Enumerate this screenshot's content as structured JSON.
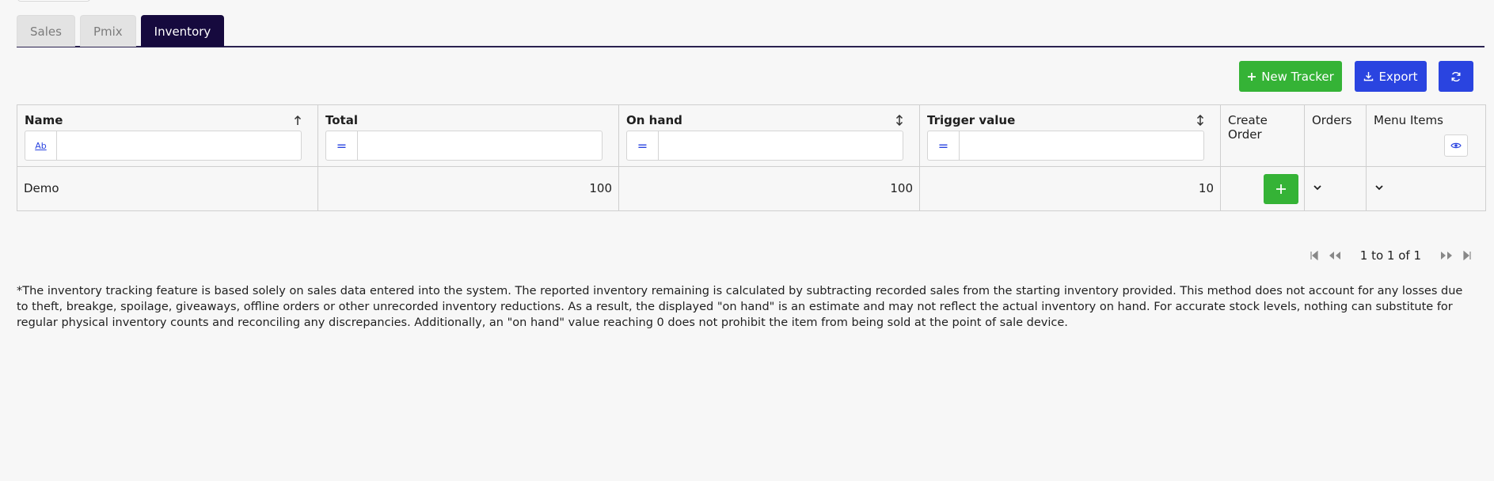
{
  "tabs": [
    {
      "label": "Sales",
      "active": false
    },
    {
      "label": "Pmix",
      "active": false
    },
    {
      "label": "Inventory",
      "active": true
    }
  ],
  "toolbar": {
    "new_tracker_label": "New Tracker",
    "export_label": "Export",
    "refresh_icon": "refresh-icon"
  },
  "colors": {
    "active_tab": "#160a3e",
    "green": "#35b336",
    "blue": "#2a44e0"
  },
  "grid": {
    "columns": {
      "name": "Name",
      "total": "Total",
      "on_hand": "On hand",
      "trigger_value": "Trigger value",
      "create_order": "Create Order",
      "orders": "Orders",
      "menu_items": "Menu Items"
    },
    "filters": {
      "name_type": "Ab",
      "total_type": "=",
      "on_hand_type": "=",
      "trigger_type": "=",
      "name_value": "",
      "total_value": "",
      "on_hand_value": "",
      "trigger_value": ""
    },
    "rows": [
      {
        "name": "Demo",
        "total": "100",
        "on_hand": "100",
        "trigger_value": "10"
      }
    ]
  },
  "pager": {
    "text": "1 to 1 of 1"
  },
  "note": "*The inventory tracking feature is based solely on sales data entered into the system. The reported inventory remaining is calculated by subtracting recorded sales from the starting inventory provided. This method does not account for any losses due to theft, breakge, spoilage, giveaways, offline orders or other unrecorded inventory reductions. As a result, the displayed \"on hand\" is an estimate and may not reflect the actual inventory on hand. For accurate stock levels, nothing can substitute for regular physical inventory counts and reconciling any discrepancies. Additionally, an \"on hand\" value reaching 0 does not prohibit the item from being sold at the point of sale device."
}
